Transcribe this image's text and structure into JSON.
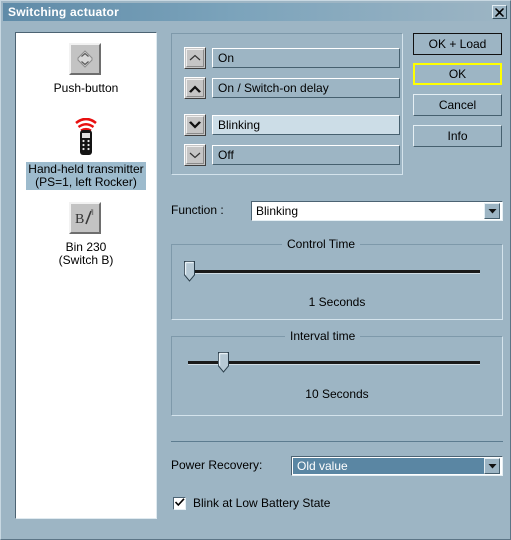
{
  "window": {
    "title": "Switching actuator",
    "close_icon": "close-x-icon"
  },
  "device_list": {
    "items": [
      {
        "icon": "push-button-icon",
        "label": "Push-button",
        "selected": false
      },
      {
        "icon": "hand-held-transmitter-icon",
        "label": "Hand-held transmitter\n(PS=1, left Rocker)",
        "selected": true
      },
      {
        "icon": "bin-230-icon",
        "label": "Bin 230\n(Switch B)",
        "selected": false
      }
    ]
  },
  "function_list": {
    "rows": [
      {
        "arrow": "arrow-up-thin-icon",
        "label": "On",
        "active": false
      },
      {
        "arrow": "arrow-up-bold-icon",
        "label": "On / Switch-on delay",
        "active": false
      },
      {
        "arrow": "arrow-down-bold-icon",
        "label": "Blinking",
        "active": true
      },
      {
        "arrow": "arrow-down-thin-icon",
        "label": "Off",
        "active": false
      }
    ]
  },
  "buttons": {
    "ok_load": "OK + Load",
    "ok": "OK",
    "cancel": "Cancel",
    "info": "Info"
  },
  "function_select": {
    "label": "Function :",
    "value": "Blinking",
    "arrow_icon": "chevron-down-icon"
  },
  "control_time": {
    "title": "Control Time",
    "value_text": "1 Seconds",
    "slider_percent": 0
  },
  "interval_time": {
    "title": "Interval time",
    "value_text": "10 Seconds",
    "slider_percent": 12
  },
  "power_recovery": {
    "label": "Power Recovery:",
    "value": "Old value",
    "arrow_icon": "chevron-down-icon",
    "highlight_color": "#5a86a3"
  },
  "blink_option": {
    "label": "Blink at Low Battery State",
    "checked": true,
    "check_icon": "checkmark-icon"
  },
  "colors": {
    "window_background": "#9db5c4",
    "title_start": "#5f8ba8",
    "focus_outline": "#ffff00",
    "selection_background": "#9dbbcd"
  }
}
